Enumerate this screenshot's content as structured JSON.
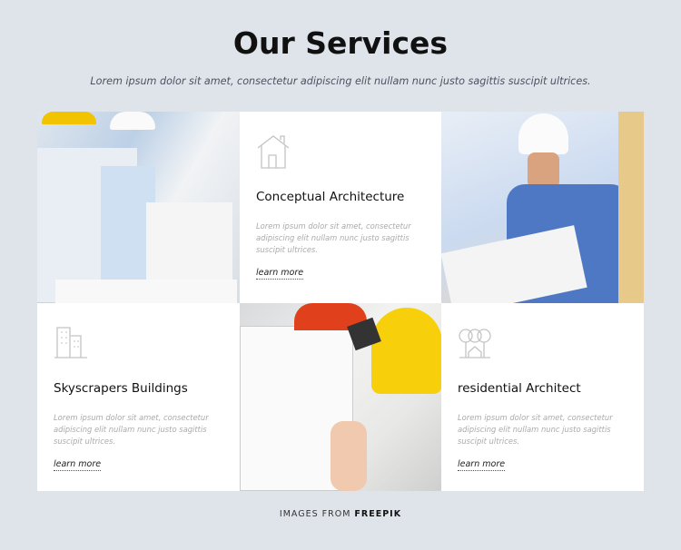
{
  "header": {
    "title": "Our Services",
    "subtitle": "Lorem ipsum dolor sit amet, consectetur adipiscing elit nullam nunc justo sagittis suscipit ultrices."
  },
  "cards": [
    {
      "icon": "house-icon",
      "title": "Conceptual Architecture",
      "text": "Lorem ipsum dolor sit amet, consectetur adipiscing elit nullam nunc justo sagittis suscipit ultrices.",
      "link": "learn more"
    },
    {
      "icon": "buildings-icon",
      "title": "Skyscrapers Buildings",
      "text": "Lorem ipsum dolor sit amet, consectetur adipiscing elit nullam nunc justo sagittis suscipit ultrices.",
      "link": "learn more"
    },
    {
      "icon": "trees-house-icon",
      "title": "residential Architect",
      "text": "Lorem ipsum dolor sit amet, consectetur adipiscing elit nullam nunc justo sagittis suscipit ultrices.",
      "link": "learn more"
    }
  ],
  "footer": {
    "prefix": "IMAGES FROM",
    "brand": "FREEPIK"
  },
  "colors": {
    "background": "#dfe3ea",
    "card": "#ffffff",
    "icon": "#c4c4c4"
  }
}
